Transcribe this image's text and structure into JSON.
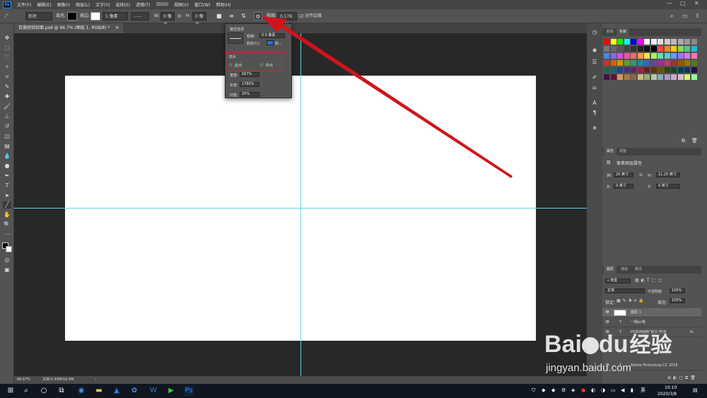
{
  "menubar": {
    "logo": "Ps",
    "items": [
      "文件(F)",
      "编辑(E)",
      "图像(I)",
      "图层(L)",
      "文字(Y)",
      "选择(S)",
      "滤镜(T)",
      "3D(D)",
      "视图(V)",
      "窗口(W)",
      "帮助(H)"
    ],
    "window_controls": [
      "—",
      "▢",
      "✕"
    ]
  },
  "options": {
    "mode": "形状",
    "fill_label": "填充:",
    "stroke_label": "描边:",
    "stroke_width": "1 像素",
    "w_label": "W:",
    "w_value": "0 像素",
    "h_label": "H:",
    "h_value": "0 像素",
    "weight_label": "粗细:",
    "weight_value": "0.176 厘米",
    "align_edges": "对齐边缘"
  },
  "document": {
    "tab_title": "百度经验封面.psd @ 66.7% (图层 1, RGB/8) *",
    "zoom": "66.67%",
    "doc_info": "文档:5.93M/18.5M"
  },
  "path_popup": {
    "title": "路径选项",
    "weight_label": "粗细:",
    "weight_value": "0.5 像素",
    "color_label": "颜色(C):",
    "color_value": "默...",
    "color_swatch": "#2b6fd4",
    "arrow_section": "箭头",
    "start_label": "起点",
    "end_label": "终点",
    "width_label": "宽度:",
    "width_value": "567%",
    "length_label": "长度:",
    "length_value": "1780%",
    "concavity_label": "凹度:",
    "concavity_value": "25%"
  },
  "swatches_panel": {
    "tabs": [
      "颜色",
      "色板"
    ],
    "colors": [
      "#ff0000",
      "#ffff00",
      "#00ff00",
      "#00ffff",
      "#0000ff",
      "#ff00ff",
      "#ffffff",
      "#eeeeee",
      "#dddddd",
      "#cccccc",
      "#bbbbbb",
      "#aaaaaa",
      "#999999",
      "#888888",
      "#777777",
      "#666666",
      "#555555",
      "#444444",
      "#333333",
      "#222222",
      "#111111",
      "#000000",
      "#ff4444",
      "#ff8800",
      "#ffcc00",
      "#88dd44",
      "#44cc88",
      "#22bbcc",
      "#4488ee",
      "#8866ee",
      "#cc55dd",
      "#ee5599",
      "#ff6666",
      "#ff9944",
      "#ffdd55",
      "#aaee66",
      "#66ddaa",
      "#55ccdd",
      "#6699ff",
      "#9977ff",
      "#dd77ee",
      "#ff77aa",
      "#cc3333",
      "#cc6600",
      "#cc9900",
      "#669933",
      "#339966",
      "#228899",
      "#3366bb",
      "#664499",
      "#993399",
      "#cc3366",
      "#993333",
      "#995500",
      "#997700",
      "#557722",
      "#226644",
      "#116677",
      "#224488",
      "#443377",
      "#662266",
      "#992244",
      "#662222",
      "#663300",
      "#665500",
      "#334411",
      "#114433",
      "#004455",
      "#113366",
      "#221144",
      "#441144",
      "#661133",
      "#cc9966",
      "#aa7744",
      "#886644",
      "#ccbb88",
      "#99aa77",
      "#aaccaa",
      "#88aabb",
      "#aa99cc",
      "#ccaacc",
      "#ddbbcc",
      "#ccff66",
      "#99ff99"
    ]
  },
  "properties_panel": {
    "tabs": [
      "属性",
      "调整"
    ],
    "header": "像素图层属性",
    "w_label": "W:",
    "w_value": "20 英寸",
    "h_label": "H:",
    "h_value": "11.25 英寸",
    "x_label": "X:",
    "x_value": "0 英寸",
    "y_label": "Y:",
    "y_value": "0 英寸"
  },
  "layers_panel": {
    "tabs": [
      "图层",
      "通道",
      "路径"
    ],
    "filter": "类型",
    "blend": "正常",
    "opacity_label": "不透明度:",
    "opacity": "100%",
    "lock_label": "锁定:",
    "fill_label": "填充:",
    "fill": "100%",
    "layers": [
      {
        "name": "图层 1",
        "type": "pixel"
      },
      {
        "name": "一眼ps哦",
        "type": "text"
      },
      {
        "name": "PS如何绘制\"箭头\"形状",
        "type": "text"
      },
      {
        "name": "Adobe Photoshop CC 2018",
        "type": "text"
      }
    ]
  },
  "taskbar": {
    "time": "10:10",
    "date": "2020/3/8",
    "ime": "英"
  },
  "watermark": {
    "brand": "Bai",
    "brand2": "du",
    "cn": "经验",
    "url": "jingyan.baidu.com"
  }
}
